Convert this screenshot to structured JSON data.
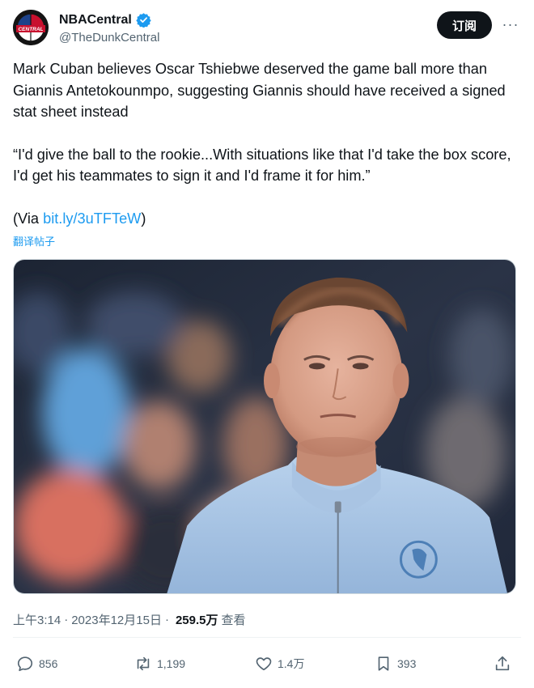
{
  "account": {
    "display_name": "NBACentral",
    "handle": "@TheDunkCentral",
    "avatar_text": "CENTRAL"
  },
  "header": {
    "subscribe_label": "订阅",
    "more_label": "···"
  },
  "tweet": {
    "paragraph1": "Mark Cuban believes Oscar Tshiebwe deserved the game ball more than Giannis Antetokounmpo, suggesting Giannis should have received a signed stat sheet instead",
    "paragraph2": "“I'd give the ball to the rookie...With situations like that I'd take the box score, I'd get his teammates to sign it and I'd frame it for him.”",
    "via_prefix": "(Via ",
    "via_link": "bit.ly/3uTFTeW",
    "via_suffix": ")",
    "translate_label": "翻译帖子"
  },
  "meta": {
    "time": "上午3:14",
    "separator": "·",
    "date": "2023年12月15日",
    "views": "259.5万",
    "views_label": "查看"
  },
  "actions": {
    "replies": "856",
    "retweets": "1,199",
    "likes": "1.4万",
    "bookmarks": "393"
  },
  "colors": {
    "link": "#1d9bf0",
    "text": "#0f1419",
    "secondary": "#536471",
    "verified": "#1d9bf0"
  },
  "icons": {
    "verified": "verified-badge-icon",
    "reply": "reply-icon",
    "retweet": "retweet-icon",
    "like": "heart-icon",
    "bookmark": "bookmark-icon",
    "share": "share-icon",
    "more": "more-icon"
  }
}
